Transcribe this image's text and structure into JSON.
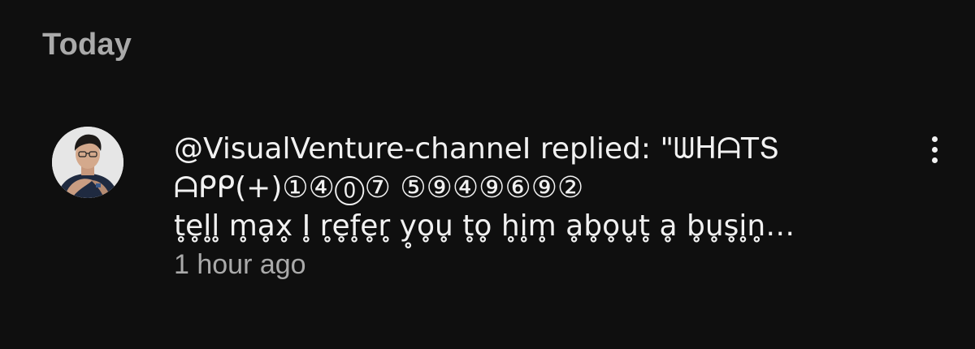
{
  "section": {
    "title": "Today"
  },
  "notification": {
    "avatar_icon": "profile-photo",
    "lines": [
      "@VisualVenture-channeI replied: \"ᗯᕼᗩTՏ",
      "ᗩᑭᑭ(+)①④⓪⑦ ⑤⑨④⑨⑥⑨②",
      "t̥e̥l̥l̥ m̥ḁx̥ I̥ r̥e̥f̥e̥r̥ y̥o̥u̥ t̥o̥ h̥i̥m̥ ḁb̥o̥u̥t̥ ḁ b̥u̥s̥i̥n̥…"
    ],
    "time": "1 hour ago",
    "menu_icon": "more-vertical-icon"
  }
}
